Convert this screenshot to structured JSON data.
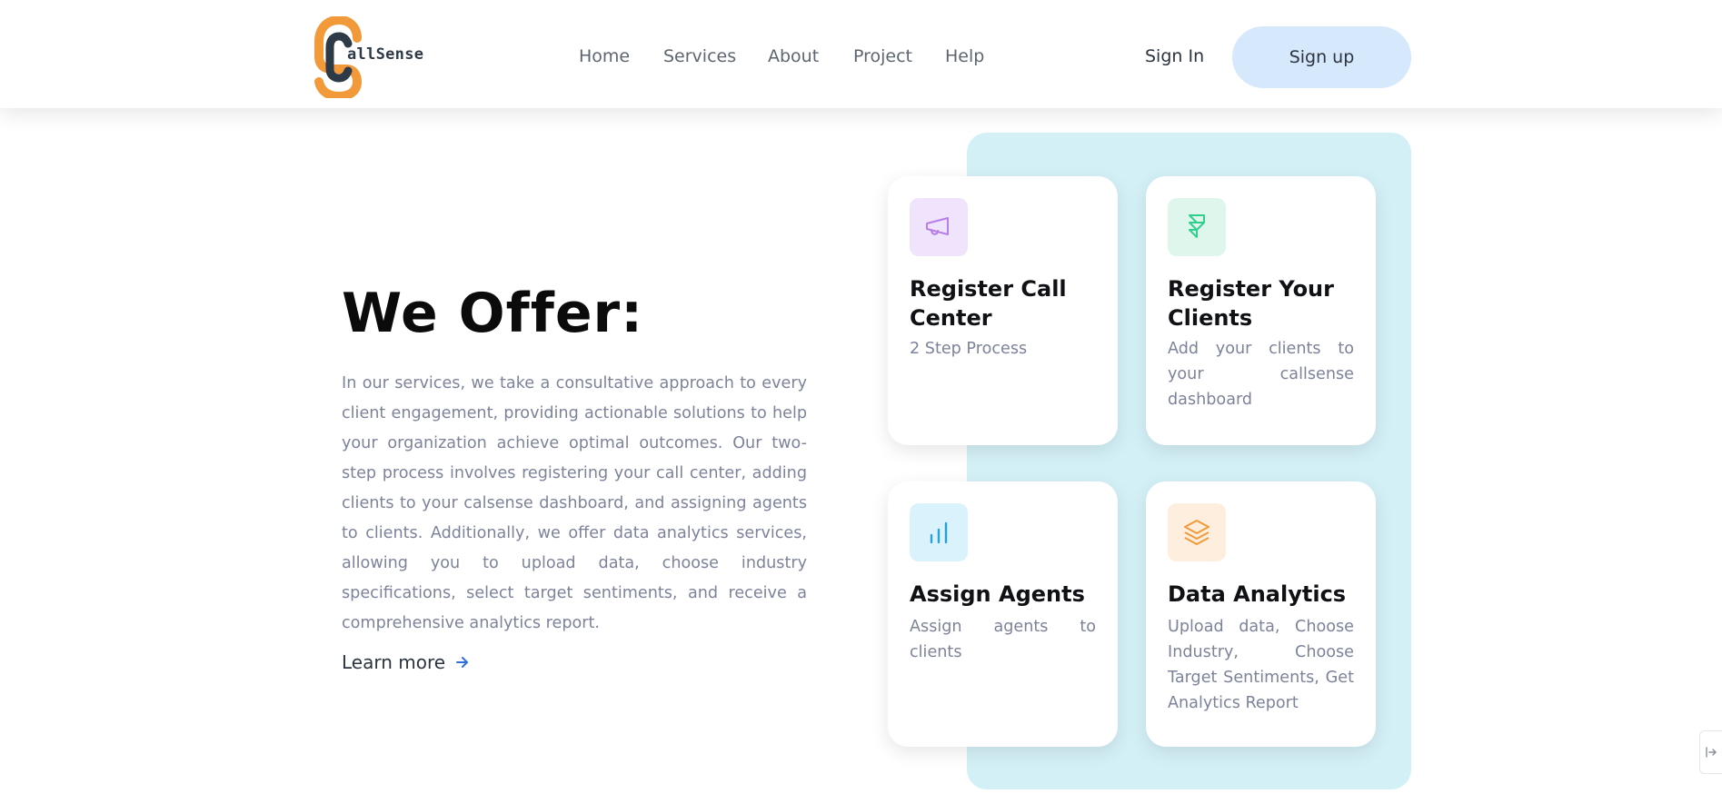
{
  "brand": {
    "name": "allSense",
    "colors": {
      "orange": "#f2993a",
      "dark": "#2e3a46"
    }
  },
  "nav": {
    "items": [
      {
        "label": "Home"
      },
      {
        "label": "Services"
      },
      {
        "label": "About"
      },
      {
        "label": "Project"
      },
      {
        "label": "Help"
      }
    ],
    "signin_label": "Sign In",
    "signup_label": "Sign up"
  },
  "hero": {
    "heading": "We Offer:",
    "description": "In our services, we take a consultative approach to every client engagement, providing actionable solutions to help your organization achieve optimal outcomes. Our two-step process involves registering your call center, adding clients to your calsense dashboard, and assigning agents to clients. Additionally, we offer data analytics services, allowing you to upload data, choose industry specifications, select target sentiments, and receive a comprehensive analytics report.",
    "learn_more": "Learn more"
  },
  "cards": [
    {
      "icon": "megaphone-icon",
      "title": "Register Call Center",
      "text": "2 Step Process",
      "accent": "#b77ee6"
    },
    {
      "icon": "framer-icon",
      "title": "Register Your Clients",
      "text": "Add your clients to your callsense dashboard",
      "accent": "#2fd08d"
    },
    {
      "icon": "bar-chart-icon",
      "title": "Assign Agents",
      "text": "Assign agents to clients",
      "accent": "#27a2d6"
    },
    {
      "icon": "layers-icon",
      "title": "Data Analytics",
      "text": "Upload data, Choose Industry, Choose Target Sentiments, Get Analytics Report",
      "accent": "#f2993a"
    }
  ],
  "colors": {
    "panel": "#d4f0f7",
    "signup_bg": "#d6e8fb",
    "body_text": "#7c839a",
    "link_arrow": "#2f6fe0"
  }
}
